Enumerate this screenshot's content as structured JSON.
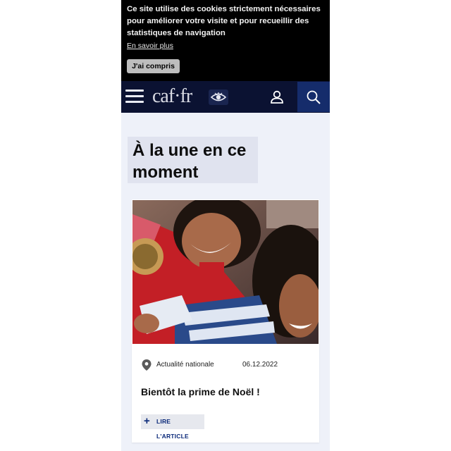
{
  "cookie_banner": {
    "message": "Ce site utilise des cookies strictement nécessaires pour améliorer votre visite et pour recueillir des statistiques de navigation",
    "learn_more": "En savoir plus",
    "accept_label": "J'ai compris"
  },
  "header": {
    "logo_text": "caf·fr",
    "icons": [
      "menu-icon",
      "eye-accessibility-icon",
      "user-icon",
      "search-icon"
    ]
  },
  "main": {
    "section_title": "À la une en ce moment",
    "article": {
      "category": "Actualité nationale",
      "date": "06.12.2022",
      "title": "Bientôt la prime de Noël !",
      "cta_label": "LIRE L'ARTICLE",
      "icons": [
        "location-pin-icon",
        "plus-icon"
      ]
    }
  },
  "colors": {
    "header_bg": "#0b1232",
    "search_bg": "#152c6b",
    "page_bg": "#eef1f9",
    "cta_text": "#0b2a7a"
  }
}
